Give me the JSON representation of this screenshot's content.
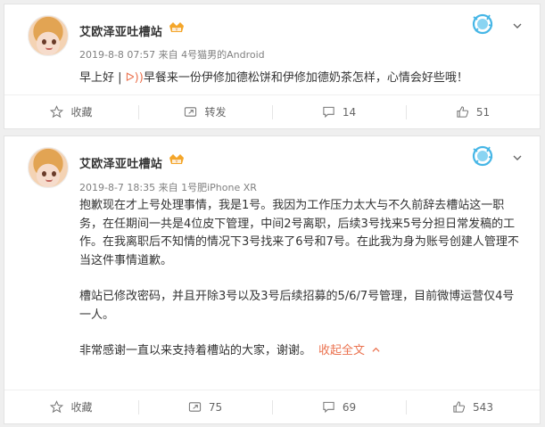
{
  "colors": {
    "accent": "#eb7350",
    "meta": "#808080",
    "text": "#333333",
    "background": "#efefef"
  },
  "posts": [
    {
      "author": "艾欧泽亚吐槽站",
      "badge_icon": "vip-badge-icon",
      "meta": "2019-8-8 07:57 来自 4号猫男的Android",
      "text_prefix": "早上好 |",
      "sound_glyph": "ᐅ))",
      "text_body": "早餐来一份伊修加德松饼和伊修加德奶茶怎样，心情会好些哦！",
      "actions": {
        "favorite": "收藏",
        "repost": "转发",
        "comments": "14",
        "likes": "51"
      }
    },
    {
      "author": "艾欧泽亚吐槽站",
      "badge_icon": "vip-badge-icon",
      "meta": "2019-8-7 18:35 来自 1号肥iPhone XR",
      "paragraphs": [
        "抱歉现在才上号处理事情，我是1号。我因为工作压力太大与不久前辞去槽站这一职务，在任期间一共是4位皮下管理，中间2号离职，后续3号找来5号分担日常发稿的工作。在我离职后不知情的情况下3号找来了6号和7号。在此我为身为账号创建人管理不当这件事情道歉。",
        "槽站已修改密码，并且开除3号以及3号后续招募的5/6/7号管理，目前微博运营仅4号一人。",
        "非常感谢一直以来支持着槽站的大家，谢谢。"
      ],
      "collapse_label": "收起全文",
      "actions": {
        "favorite": "收藏",
        "reposts": "75",
        "comments": "69",
        "likes": "543"
      }
    }
  ]
}
